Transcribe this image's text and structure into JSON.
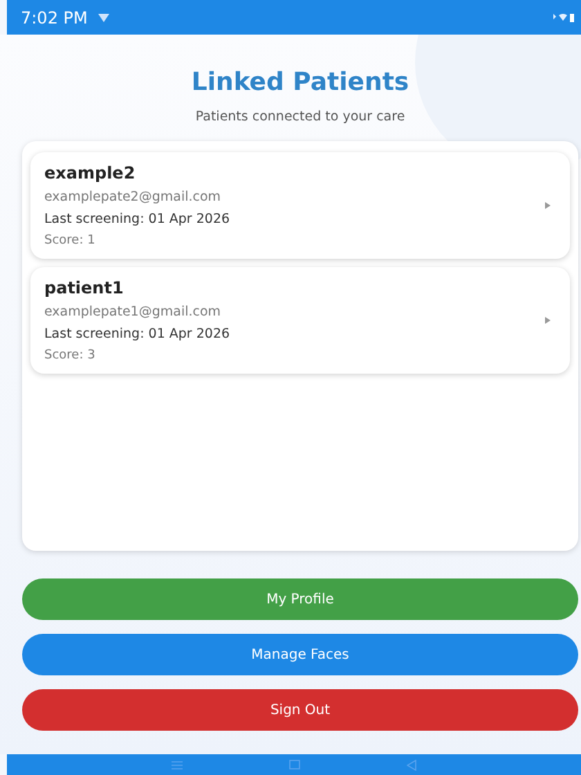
{
  "status_bar": {
    "time": "7:02 PM"
  },
  "header": {
    "title": "Linked Patients",
    "subtitle": "Patients connected to your care"
  },
  "patients": [
    {
      "name": "example2",
      "email": "examplepate2@gmail.com",
      "last_screening": "Last screening: 01 Apr 2026",
      "score": "Score: 1"
    },
    {
      "name": "patient1",
      "email": "examplepate1@gmail.com",
      "last_screening": "Last screening: 01 Apr 2026",
      "score": "Score: 3"
    }
  ],
  "buttons": [
    {
      "label": "My Profile",
      "color": "#43a047"
    },
    {
      "label": "Manage Faces",
      "color": "#1e88e5"
    },
    {
      "label": "Sign Out",
      "color": "#d32f2f"
    }
  ]
}
